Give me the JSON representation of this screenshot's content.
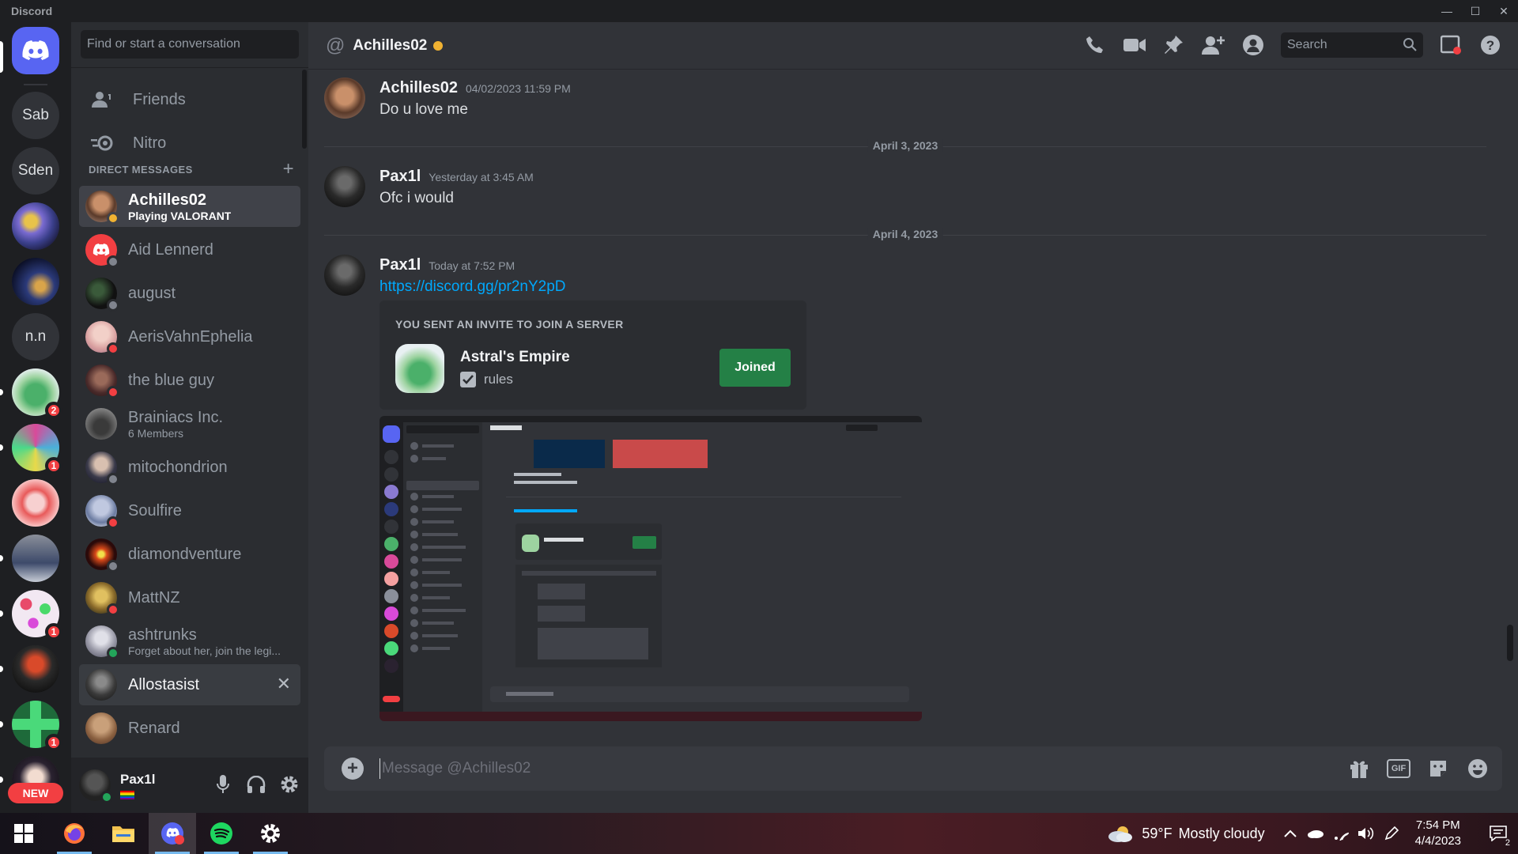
{
  "window": {
    "app_name": "Discord",
    "controls": [
      "—",
      "☐",
      "✕"
    ]
  },
  "guilds": {
    "text_servers": [
      {
        "label": "Sab",
        "top": 0
      },
      {
        "label": "Sden"
      },
      {
        "label": "n.n"
      }
    ],
    "badges": [
      "2",
      "1",
      "1",
      "1"
    ],
    "new_label": "NEW"
  },
  "dm_sidebar": {
    "search_placeholder": "Find or start a conversation",
    "friends_label": "Friends",
    "nitro_label": "Nitro",
    "direct_messages_label": "DIRECT MESSAGES",
    "add_dm": "+",
    "dms": [
      {
        "name": "Achilles02",
        "sub": "Playing VALORANT",
        "status": "#f0b232"
      },
      {
        "name": "Aid Lennerd",
        "sub": "",
        "status": "#80848e"
      },
      {
        "name": "august",
        "sub": "",
        "status": "#80848e"
      },
      {
        "name": "AerisVahnEphelia",
        "sub": "",
        "status": "#f23f42"
      },
      {
        "name": "the blue guy",
        "sub": "",
        "status": "#f23f42"
      },
      {
        "name": "Brainiacs Inc.",
        "sub": "6 Members",
        "status": ""
      },
      {
        "name": "mitochondrion",
        "sub": "",
        "status": "#80848e"
      },
      {
        "name": "Soulfire",
        "sub": "",
        "status": "#f23f42"
      },
      {
        "name": "diamondventure",
        "sub": "",
        "status": "#80848e"
      },
      {
        "name": "MattNZ",
        "sub": "",
        "status": "#f23f42"
      },
      {
        "name": "ashtrunks",
        "sub": "Forget about her, join the legi...",
        "status": "#23a55a"
      },
      {
        "name": "Allostasist",
        "sub": "",
        "status": ""
      },
      {
        "name": "Renard",
        "sub": "",
        "status": ""
      }
    ],
    "close_dm": "✕"
  },
  "user_panel": {
    "username": "Pax1l"
  },
  "chat": {
    "header_title": "Achilles02",
    "search_placeholder": "Search",
    "messages": [
      {
        "author": "Achilles02",
        "time": "04/02/2023 11:59 PM",
        "text": "Do u love me"
      },
      {
        "author": "Pax1l",
        "time": "Yesterday at 3:45 AM",
        "text": "Ofc i would"
      },
      {
        "author": "Pax1l",
        "time": "Today at 7:52 PM",
        "text": "https://discord.gg/pr2nY2pD"
      }
    ],
    "dividers": [
      "April 3, 2023",
      "April 4, 2023"
    ],
    "invite": {
      "label": "YOU SENT AN INVITE TO JOIN A SERVER",
      "server_name": "Astral's Empire",
      "channel": "rules",
      "button": "Joined"
    },
    "composer_placeholder": "Message @Achilles02",
    "gif_label": "GIF"
  },
  "taskbar": {
    "temperature": "59°F",
    "weather": "Mostly cloudy",
    "time": "7:54 PM",
    "date": "4/4/2023",
    "notification_count": "2"
  },
  "colors": {
    "accent": "#5865f2",
    "online": "#23a55a",
    "idle": "#f0b232",
    "dnd": "#f23f42",
    "offline": "#80848e",
    "link": "#00a8fc",
    "joined_button": "#248046"
  }
}
